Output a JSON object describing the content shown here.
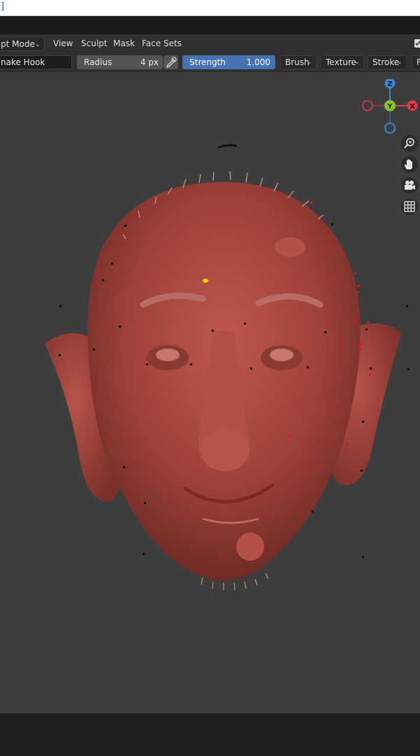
{
  "top_strip": {
    "bracket_text": "]"
  },
  "header": {
    "mode_label": "pt Mode",
    "menus": [
      "View",
      "Sculpt",
      "Mask",
      "Face Sets"
    ]
  },
  "toolbar": {
    "brush_name": "nake Hook",
    "radius": {
      "label": "Radius",
      "value": "4 px"
    },
    "strength": {
      "label": "Strength",
      "value": "1.000"
    },
    "dropdowns": [
      "Brush",
      "Texture",
      "Stroke"
    ],
    "cut_off_label": "F"
  },
  "gizmo": {
    "z_label": "Z",
    "y_label": "Y",
    "x_label": "X"
  },
  "nav_tools": [
    "zoom-in-icon",
    "hand-pan-icon",
    "camera-icon",
    "grid-icon"
  ],
  "colors": {
    "accent_blue": "#4772b3",
    "model": "#a8463f",
    "axis_x": "#e0394c",
    "axis_y": "#8cc230",
    "axis_z": "#3b84d6"
  }
}
